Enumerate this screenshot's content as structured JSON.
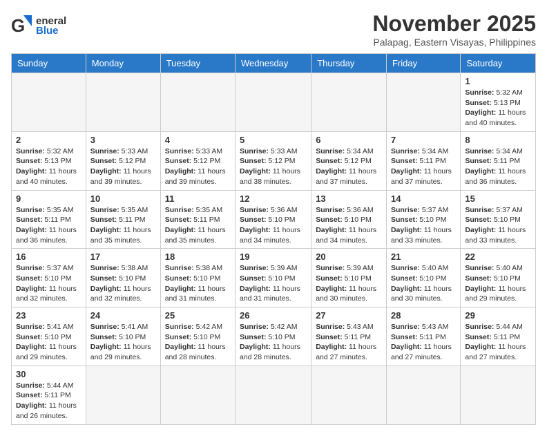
{
  "header": {
    "logo_general": "General",
    "logo_blue": "Blue",
    "month_title": "November 2025",
    "location": "Palapag, Eastern Visayas, Philippines"
  },
  "days_of_week": [
    "Sunday",
    "Monday",
    "Tuesday",
    "Wednesday",
    "Thursday",
    "Friday",
    "Saturday"
  ],
  "weeks": [
    [
      {
        "day": null,
        "sunrise": null,
        "sunset": null,
        "daylight": null
      },
      {
        "day": null,
        "sunrise": null,
        "sunset": null,
        "daylight": null
      },
      {
        "day": null,
        "sunrise": null,
        "sunset": null,
        "daylight": null
      },
      {
        "day": null,
        "sunrise": null,
        "sunset": null,
        "daylight": null
      },
      {
        "day": null,
        "sunrise": null,
        "sunset": null,
        "daylight": null
      },
      {
        "day": null,
        "sunrise": null,
        "sunset": null,
        "daylight": null
      },
      {
        "day": "1",
        "sunrise": "5:32 AM",
        "sunset": "5:13 PM",
        "daylight": "11 hours and 40 minutes."
      }
    ],
    [
      {
        "day": "2",
        "sunrise": "5:32 AM",
        "sunset": "5:13 PM",
        "daylight": "11 hours and 40 minutes."
      },
      {
        "day": "3",
        "sunrise": "5:33 AM",
        "sunset": "5:12 PM",
        "daylight": "11 hours and 39 minutes."
      },
      {
        "day": "4",
        "sunrise": "5:33 AM",
        "sunset": "5:12 PM",
        "daylight": "11 hours and 39 minutes."
      },
      {
        "day": "5",
        "sunrise": "5:33 AM",
        "sunset": "5:12 PM",
        "daylight": "11 hours and 38 minutes."
      },
      {
        "day": "6",
        "sunrise": "5:34 AM",
        "sunset": "5:12 PM",
        "daylight": "11 hours and 37 minutes."
      },
      {
        "day": "7",
        "sunrise": "5:34 AM",
        "sunset": "5:11 PM",
        "daylight": "11 hours and 37 minutes."
      },
      {
        "day": "8",
        "sunrise": "5:34 AM",
        "sunset": "5:11 PM",
        "daylight": "11 hours and 36 minutes."
      }
    ],
    [
      {
        "day": "9",
        "sunrise": "5:35 AM",
        "sunset": "5:11 PM",
        "daylight": "11 hours and 36 minutes."
      },
      {
        "day": "10",
        "sunrise": "5:35 AM",
        "sunset": "5:11 PM",
        "daylight": "11 hours and 35 minutes."
      },
      {
        "day": "11",
        "sunrise": "5:35 AM",
        "sunset": "5:11 PM",
        "daylight": "11 hours and 35 minutes."
      },
      {
        "day": "12",
        "sunrise": "5:36 AM",
        "sunset": "5:10 PM",
        "daylight": "11 hours and 34 minutes."
      },
      {
        "day": "13",
        "sunrise": "5:36 AM",
        "sunset": "5:10 PM",
        "daylight": "11 hours and 34 minutes."
      },
      {
        "day": "14",
        "sunrise": "5:37 AM",
        "sunset": "5:10 PM",
        "daylight": "11 hours and 33 minutes."
      },
      {
        "day": "15",
        "sunrise": "5:37 AM",
        "sunset": "5:10 PM",
        "daylight": "11 hours and 33 minutes."
      }
    ],
    [
      {
        "day": "16",
        "sunrise": "5:37 AM",
        "sunset": "5:10 PM",
        "daylight": "11 hours and 32 minutes."
      },
      {
        "day": "17",
        "sunrise": "5:38 AM",
        "sunset": "5:10 PM",
        "daylight": "11 hours and 32 minutes."
      },
      {
        "day": "18",
        "sunrise": "5:38 AM",
        "sunset": "5:10 PM",
        "daylight": "11 hours and 31 minutes."
      },
      {
        "day": "19",
        "sunrise": "5:39 AM",
        "sunset": "5:10 PM",
        "daylight": "11 hours and 31 minutes."
      },
      {
        "day": "20",
        "sunrise": "5:39 AM",
        "sunset": "5:10 PM",
        "daylight": "11 hours and 30 minutes."
      },
      {
        "day": "21",
        "sunrise": "5:40 AM",
        "sunset": "5:10 PM",
        "daylight": "11 hours and 30 minutes."
      },
      {
        "day": "22",
        "sunrise": "5:40 AM",
        "sunset": "5:10 PM",
        "daylight": "11 hours and 29 minutes."
      }
    ],
    [
      {
        "day": "23",
        "sunrise": "5:41 AM",
        "sunset": "5:10 PM",
        "daylight": "11 hours and 29 minutes."
      },
      {
        "day": "24",
        "sunrise": "5:41 AM",
        "sunset": "5:10 PM",
        "daylight": "11 hours and 29 minutes."
      },
      {
        "day": "25",
        "sunrise": "5:42 AM",
        "sunset": "5:10 PM",
        "daylight": "11 hours and 28 minutes."
      },
      {
        "day": "26",
        "sunrise": "5:42 AM",
        "sunset": "5:10 PM",
        "daylight": "11 hours and 28 minutes."
      },
      {
        "day": "27",
        "sunrise": "5:43 AM",
        "sunset": "5:11 PM",
        "daylight": "11 hours and 27 minutes."
      },
      {
        "day": "28",
        "sunrise": "5:43 AM",
        "sunset": "5:11 PM",
        "daylight": "11 hours and 27 minutes."
      },
      {
        "day": "29",
        "sunrise": "5:44 AM",
        "sunset": "5:11 PM",
        "daylight": "11 hours and 27 minutes."
      }
    ],
    [
      {
        "day": "30",
        "sunrise": "5:44 AM",
        "sunset": "5:11 PM",
        "daylight": "11 hours and 26 minutes."
      },
      {
        "day": null,
        "sunrise": null,
        "sunset": null,
        "daylight": null
      },
      {
        "day": null,
        "sunrise": null,
        "sunset": null,
        "daylight": null
      },
      {
        "day": null,
        "sunrise": null,
        "sunset": null,
        "daylight": null
      },
      {
        "day": null,
        "sunrise": null,
        "sunset": null,
        "daylight": null
      },
      {
        "day": null,
        "sunrise": null,
        "sunset": null,
        "daylight": null
      },
      {
        "day": null,
        "sunrise": null,
        "sunset": null,
        "daylight": null
      }
    ]
  ],
  "labels": {
    "sunrise": "Sunrise:",
    "sunset": "Sunset:",
    "daylight": "Daylight:"
  }
}
